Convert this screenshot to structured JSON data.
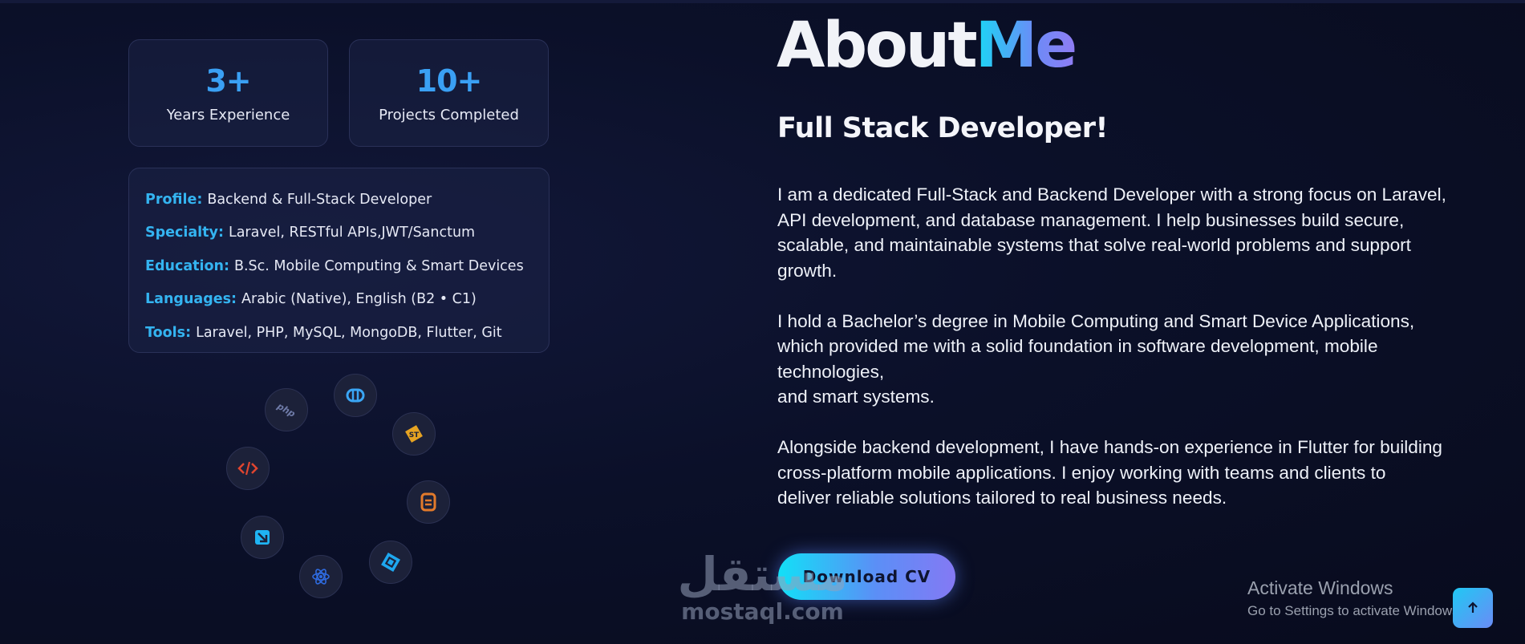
{
  "stats": [
    {
      "value": "3+",
      "label": "Years Experience"
    },
    {
      "value": "10+",
      "label": "Projects Completed"
    }
  ],
  "profile": [
    {
      "key": "Profile:",
      "value": "Backend & Full-Stack Developer"
    },
    {
      "key": "Specialty:",
      "value": "Laravel, RESTful APIs,JWT/Sanctum"
    },
    {
      "key": "Education:",
      "value": "B.Sc. Mobile Computing & Smart Devices"
    },
    {
      "key": "Languages:",
      "value": "Arabic (Native), English (B2 • C1)"
    },
    {
      "key": "Tools:",
      "value": "Laravel, PHP, MySQL, MongoDB, Flutter, Git"
    }
  ],
  "tech_icons": [
    {
      "name": "php-icon",
      "label": "php"
    },
    {
      "name": "api-icon"
    },
    {
      "name": "sublime-icon",
      "label": "ST"
    },
    {
      "name": "code-icon"
    },
    {
      "name": "database-icon"
    },
    {
      "name": "figma-icon"
    },
    {
      "name": "react-icon"
    },
    {
      "name": "flutter-icon"
    }
  ],
  "about": {
    "title_part1": "About",
    "title_part2": "Me",
    "subtitle": "Full Stack Developer!",
    "paragraphs": [
      [
        "I am a dedicated Full-Stack and Backend Developer with a strong focus on Laravel,",
        "API development, and database management. I help businesses build secure,",
        "scalable, and maintainable systems that solve real-world problems and support",
        "growth."
      ],
      [
        "I hold a Bachelor’s degree in Mobile Computing and Smart Device Applications,",
        "which provided me with a solid foundation in software development, mobile",
        "technologies,",
        "and smart systems."
      ],
      [
        "Alongside backend development, I have hands-on experience in Flutter for building",
        "cross-platform mobile applications. I enjoy working with teams and clients to",
        "deliver reliable solutions tailored to real business needs."
      ]
    ],
    "download_label": "Download CV"
  },
  "watermark": {
    "arabic": "مستقل",
    "latin": "mostaql.com"
  },
  "activate_windows": {
    "title": "Activate Windows",
    "subtitle": "Go to Settings to activate Windows."
  },
  "colors": {
    "accent_cyan": "#1ad7f5",
    "accent_blue": "#3aa0f4",
    "accent_violet": "#8f7cf4",
    "background": "#0b1029"
  }
}
